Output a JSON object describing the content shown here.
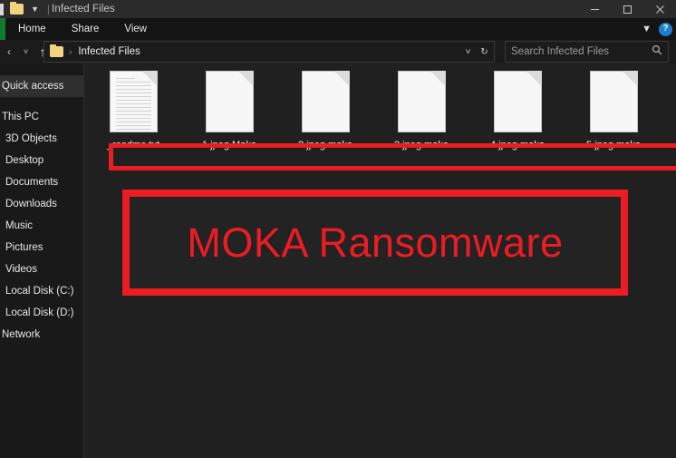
{
  "window": {
    "title": "Infected Files",
    "quick_access_toolbar": {
      "folder_icon": "folder-icon",
      "dropdown_icon": "chevron-down-icon",
      "separator": "|"
    },
    "controls": {
      "minimize": "minimize-icon",
      "maximize": "maximize-icon",
      "close": "close-icon"
    }
  },
  "ribbon": {
    "tabs": [
      {
        "label": "Home"
      },
      {
        "label": "Share"
      },
      {
        "label": "View"
      }
    ],
    "expand_icon": "chevron-down-icon",
    "help_label": "?"
  },
  "addressbar": {
    "nav": {
      "back": "‹",
      "forward": "›",
      "recent": "˅",
      "up": "↑"
    },
    "path_text": "Infected Files",
    "path_separator": "›",
    "dropdown": "˅",
    "refresh": "↻"
  },
  "search": {
    "placeholder": "Search Infected Files",
    "icon": "search-icon"
  },
  "sidebar": {
    "items": [
      {
        "label": "Quick access",
        "selected": true
      },
      {
        "label": "This PC",
        "selected": false
      },
      {
        "label": "3D Objects",
        "selected": false
      },
      {
        "label": "Desktop",
        "selected": false
      },
      {
        "label": "Documents",
        "selected": false
      },
      {
        "label": "Downloads",
        "selected": false
      },
      {
        "label": "Music",
        "selected": false
      },
      {
        "label": "Pictures",
        "selected": false
      },
      {
        "label": "Videos",
        "selected": false
      },
      {
        "label": "Local Disk (C:)",
        "selected": false
      },
      {
        "label": "Local Disk (D:)",
        "selected": false
      },
      {
        "label": "Network",
        "selected": false
      }
    ]
  },
  "files": [
    {
      "name": "_readme.txt",
      "icon": "text-file-icon"
    },
    {
      "name": "1.jpeg.Moka",
      "icon": "blank-file-icon"
    },
    {
      "name": "2.jpeg.moka",
      "icon": "blank-file-icon"
    },
    {
      "name": "3.jpeg.moka",
      "icon": "blank-file-icon"
    },
    {
      "name": "4.jpeg.moka",
      "icon": "blank-file-icon"
    },
    {
      "name": "5.jpeg.moka",
      "icon": "blank-file-icon"
    }
  ],
  "annotations": {
    "banner_text": "MOKA Ransomware",
    "highlight_color": "#ea1d22"
  }
}
